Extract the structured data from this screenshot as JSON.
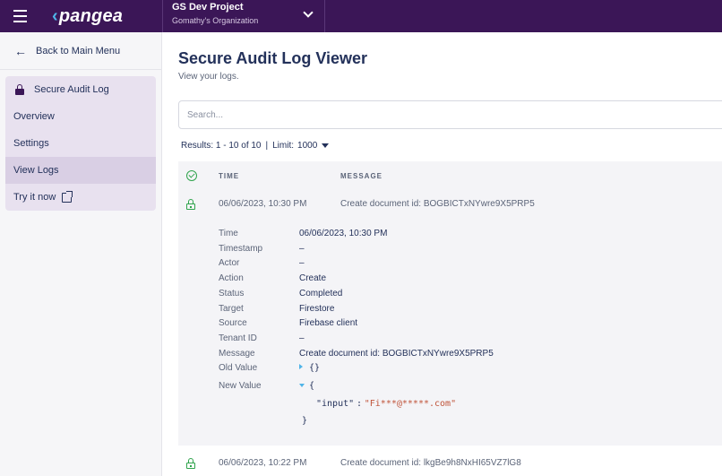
{
  "topbar": {
    "logo": "pangea",
    "project_name": "GS Dev Project",
    "org_name": "Gomathy's Organization"
  },
  "sidebar": {
    "back_label": "Back to Main Menu",
    "section_title": "Secure Audit Log",
    "items": [
      {
        "label": "Overview"
      },
      {
        "label": "Settings"
      },
      {
        "label": "View Logs",
        "active": true
      },
      {
        "label": "Try it now",
        "external": true
      }
    ]
  },
  "main": {
    "title": "Secure Audit Log Viewer",
    "subtitle": "View your logs.",
    "search_placeholder": "Search...",
    "results_text": "Results: 1 - 10 of 10",
    "limit_label": "Limit:",
    "limit_value": "1000"
  },
  "table": {
    "col_time": "TIME",
    "col_message": "MESSAGE",
    "rows": [
      {
        "time": "06/06/2023, 10:30 PM",
        "message": "Create document id: BOGBICTxNYwre9X5PRP5",
        "expanded": true,
        "details": {
          "time_label": "Time",
          "time_value": "06/06/2023, 10:30 PM",
          "timestamp_label": "Timestamp",
          "timestamp_value": "–",
          "actor_label": "Actor",
          "actor_value": "–",
          "action_label": "Action",
          "action_value": "Create",
          "status_label": "Status",
          "status_value": "Completed",
          "target_label": "Target",
          "target_value": "Firestore",
          "source_label": "Source",
          "source_value": "Firebase client",
          "tenant_label": "Tenant ID",
          "tenant_value": "–",
          "message_label": "Message",
          "message_value": "Create document id: BOGBICTxNYwre9X5PRP5",
          "old_label": "Old Value",
          "old_value": "{}",
          "new_label": "New Value",
          "new_open": "{",
          "new_key": "\"input\"",
          "new_colon": ":",
          "new_val": "\"Fi***@*****.com\"",
          "new_close": "}"
        }
      },
      {
        "time": "06/06/2023, 10:22 PM",
        "message": "Create document id: lkgBe9h8NxHI65VZ7lG8",
        "expanded": false
      }
    ]
  },
  "colors": {
    "topbar": "#3b1657",
    "accent": "#4fb4e8",
    "success": "#2fa34c"
  }
}
